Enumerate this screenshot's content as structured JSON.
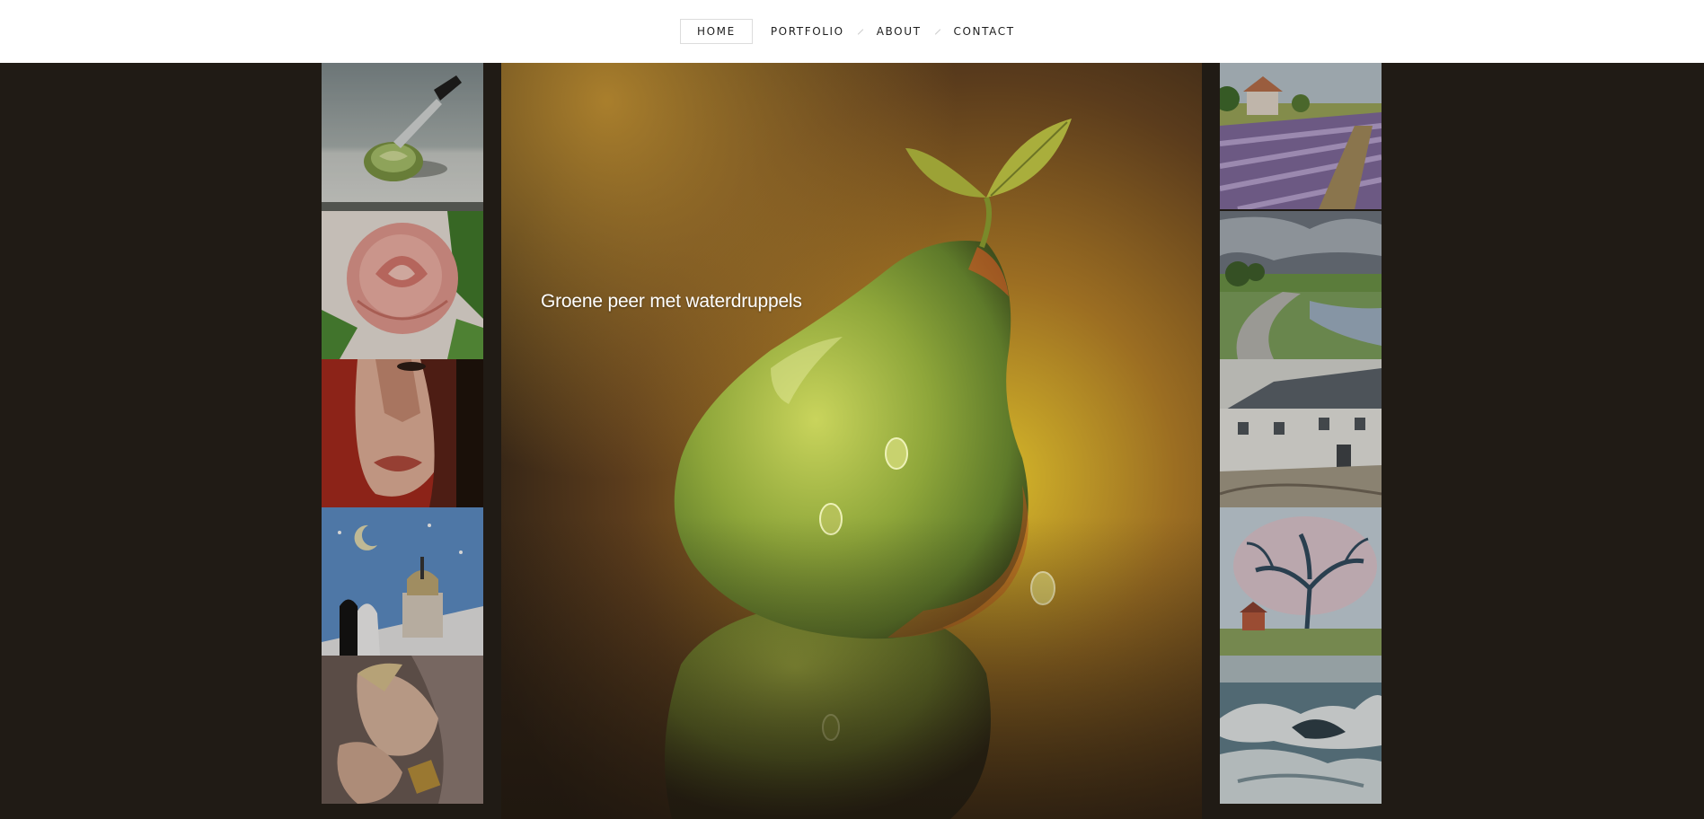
{
  "nav": {
    "items": [
      {
        "label": "HOME",
        "active": true
      },
      {
        "label": "PORTFOLIO",
        "active": false
      },
      {
        "label": "ABOUT",
        "active": false
      },
      {
        "label": "CONTACT",
        "active": false
      }
    ]
  },
  "featured": {
    "caption": "Groene peer met waterdruppels"
  },
  "colors": {
    "background": "#201b15",
    "header": "#ffffff",
    "nav_text": "#1e1e1e"
  }
}
